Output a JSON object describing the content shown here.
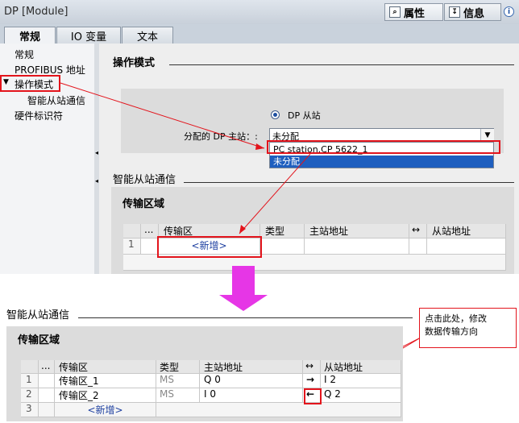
{
  "window": {
    "title": "DP [Module]"
  },
  "right_tabs": [
    {
      "label": "属性",
      "icon": "properties-icon"
    },
    {
      "label": "信息",
      "icon": "info-icon"
    }
  ],
  "window_buttons": {
    "info": "i"
  },
  "tabs": [
    {
      "label": "常规"
    },
    {
      "label": "IO 变量"
    },
    {
      "label": "文本"
    }
  ],
  "nav": {
    "items": [
      "常规",
      "PROFIBUS 地址",
      "操作模式",
      "智能从站通信",
      "硬件标识符"
    ],
    "expanded_marker": "▼"
  },
  "operation_mode": {
    "heading": "操作模式",
    "radio_label": "DP 从站",
    "master_label": "分配的 DP 主站：:",
    "selected_value": "未分配",
    "dropdown_options": [
      "PC station.CP 5622_1",
      "未分配"
    ]
  },
  "intelligent_slave": {
    "heading": "智能从站通信",
    "transfer_heading": "传输区域",
    "columns": [
      "...",
      "传输区",
      "类型",
      "主站地址",
      "↔",
      "从站地址"
    ],
    "top_rows": [
      {
        "num": "1",
        "area": "<新增>"
      }
    ],
    "bottom_rows": [
      {
        "num": "1",
        "area": "传输区_1",
        "type": "MS",
        "master": "Q 0",
        "dir": "→",
        "slave": "I 2"
      },
      {
        "num": "2",
        "area": "传输区_2",
        "type": "MS",
        "master": "I 0",
        "dir": "←",
        "slave": "Q 2"
      },
      {
        "num": "3",
        "area": "<新增>",
        "type": "",
        "master": "",
        "dir": "",
        "slave": ""
      }
    ]
  },
  "callout": {
    "text_line1": "点击此处，修改",
    "text_line2": "数据传输方向"
  },
  "colors": {
    "annotation_red": "#e3141c",
    "magenta_arrow": "#e636e6",
    "selection_blue": "#1f5fbf"
  }
}
